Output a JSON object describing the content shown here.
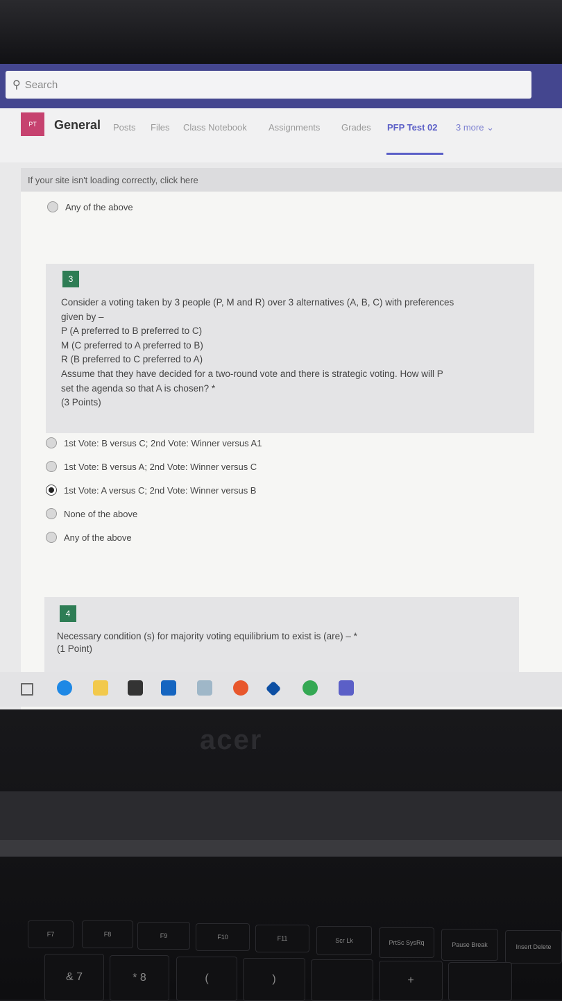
{
  "search": {
    "placeholder": "Search"
  },
  "header": {
    "team_initials": "PT",
    "channel": "General",
    "tabs": [
      "Posts",
      "Files",
      "Class Notebook",
      "Assignments",
      "Grades",
      "PFP Test 02",
      "3 more"
    ],
    "active_tab": "PFP Test 02"
  },
  "notice": "If your site isn't loading correctly, click here",
  "prev_question": {
    "last_option": "Any of the above"
  },
  "question3": {
    "number": "3",
    "lines": [
      "Consider a voting taken by 3 people (P, M and R) over 3 alternatives (A, B, C) with preferences",
      "given by –",
      "P (A preferred to B preferred to C)",
      "M (C preferred to A preferred to B)",
      "R (B preferred to C preferred to A)",
      "Assume that they have decided for a two-round vote and there is strategic voting. How will P",
      "set the agenda so that A is chosen? *",
      "(3 Points)"
    ],
    "options": [
      "1st Vote: B versus C; 2nd Vote: Winner versus A1",
      "1st Vote: B versus A; 2nd Vote: Winner versus C",
      "1st Vote: A versus C; 2nd Vote: Winner versus B",
      "None of the above",
      "Any of the above"
    ],
    "selected_index": 2
  },
  "question4": {
    "number": "4",
    "lines": [
      "Necessary condition (s) for majority voting equilibrium to exist is (are) – *",
      "(1 Point)"
    ]
  },
  "taskbar": {
    "icons": [
      "task-view-icon",
      "edge-icon",
      "file-explorer-icon",
      "store-icon",
      "mail-icon",
      "photos-icon",
      "firefox-icon",
      "dropbox-icon",
      "chrome-icon",
      "teams-icon"
    ]
  },
  "laptop": {
    "brand": "acer",
    "keys": [
      "F7",
      "F8",
      "F9",
      "F10",
      "F11",
      "Scr Lk",
      "PrtSc SysRq",
      "Pause Break",
      "Insert Delete",
      "&",
      "7",
      "*",
      "8",
      "(",
      ")",
      "+"
    ]
  }
}
